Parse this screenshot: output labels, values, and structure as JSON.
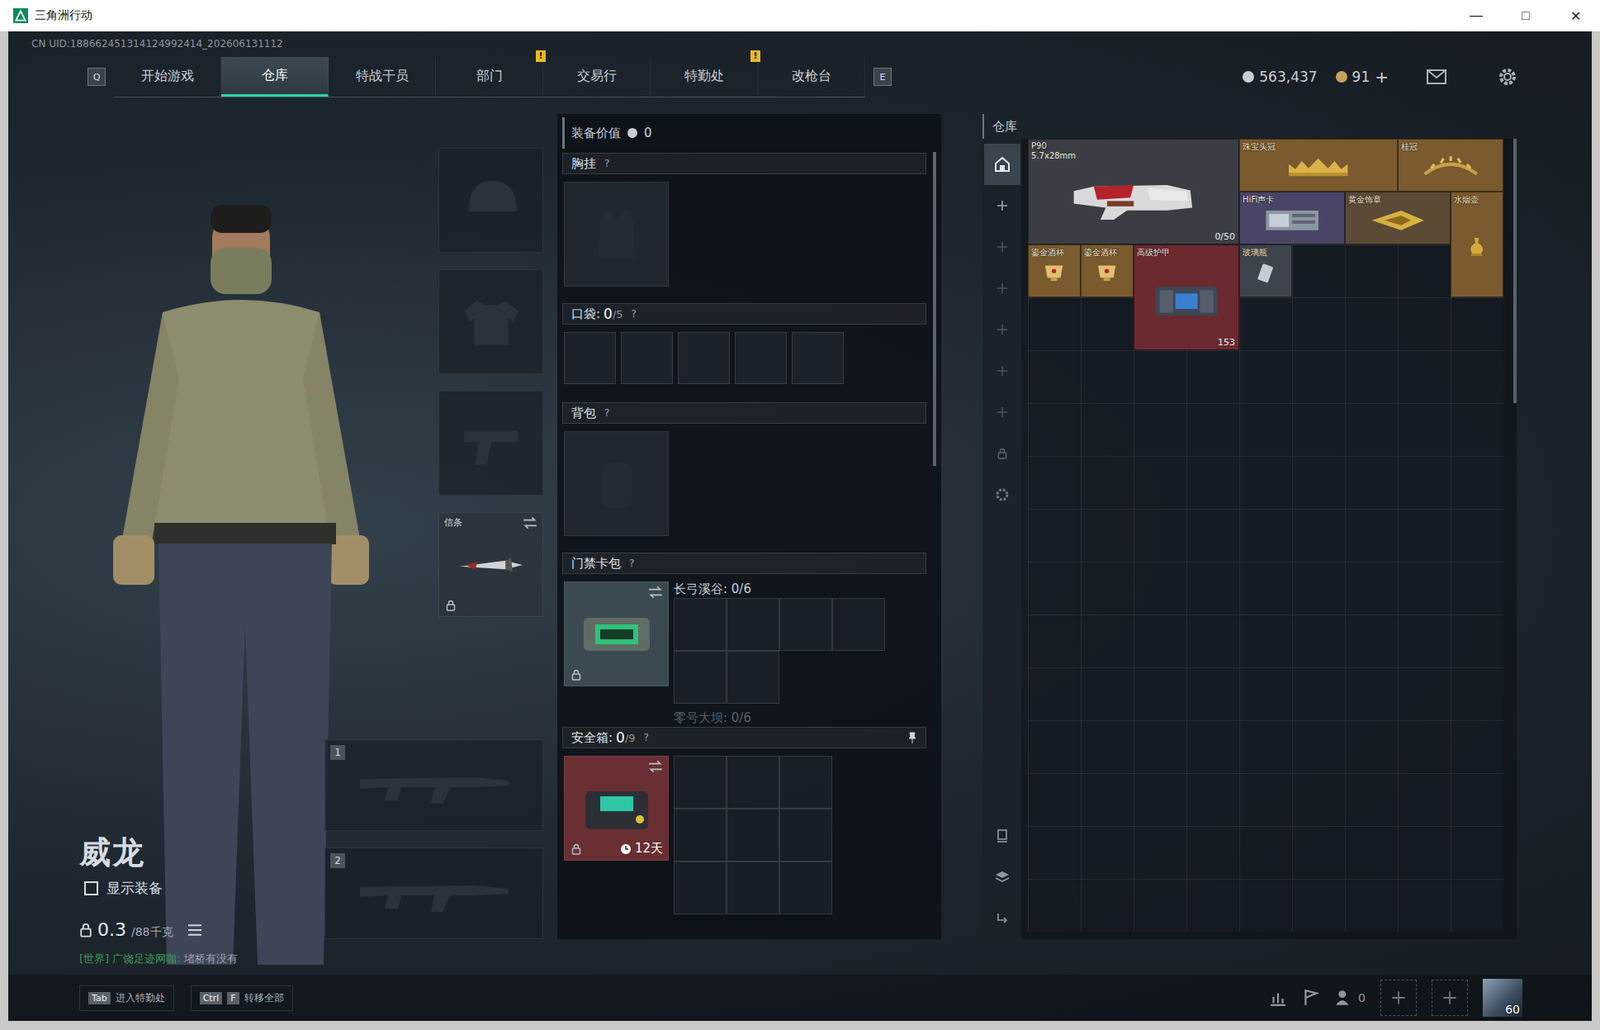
{
  "window": {
    "title": "三角洲行动",
    "controls": [
      "—",
      "□",
      "✕"
    ]
  },
  "uid": "CN UID:188662451314124992414_202606131112",
  "nav": {
    "prev_key": "Q",
    "next_key": "E",
    "tabs": [
      {
        "label": "开始游戏",
        "selected": false,
        "badge": null
      },
      {
        "label": "仓库",
        "selected": true,
        "badge": null
      },
      {
        "label": "特战干员",
        "selected": false,
        "badge": null
      },
      {
        "label": "部门",
        "selected": false,
        "badge": "!"
      },
      {
        "label": "交易行",
        "selected": false,
        "badge": null
      },
      {
        "label": "特勤处",
        "selected": false,
        "badge": "!"
      },
      {
        "label": "改枪台",
        "selected": false,
        "badge": null
      }
    ]
  },
  "currency": [
    {
      "value": "563,437",
      "color": "#c9ccd1",
      "add": null
    },
    {
      "value": "91",
      "color": "#c8a15a",
      "add": "+"
    }
  ],
  "operator": {
    "name": "威龙",
    "show_gear": {
      "label": "显示装备",
      "checked": false
    },
    "weight": "0.3",
    "capacity": "/88千克"
  },
  "chat": {
    "channel": "[世界]",
    "sender": "广饶足迹网咖:",
    "message": "堵桥有没有"
  },
  "gear_slots": [
    {
      "kind": "helmet",
      "label": "",
      "filled": false,
      "locked": false
    },
    {
      "kind": "armor",
      "label": "",
      "filled": false,
      "locked": false
    },
    {
      "kind": "pistol",
      "label": "",
      "filled": false,
      "locked": false
    },
    {
      "kind": "melee",
      "label": "信条",
      "filled": true,
      "locked": true
    }
  ],
  "weapon_slots": [
    {
      "number": "1"
    },
    {
      "number": "2"
    }
  ],
  "loadout": {
    "value_label": "装备价值",
    "value": "0",
    "chest_rig": {
      "label": "胸挂",
      "help": "?"
    },
    "pockets": {
      "label": "口袋: ",
      "used": "0",
      "capacity": "/5",
      "help": "?",
      "slots": 5
    },
    "backpack": {
      "label": "背包",
      "help": "?"
    },
    "keycard": {
      "label": "门禁卡包",
      "help": "?",
      "locked": true,
      "maps": [
        {
          "label": "长弓溪谷: 0/6",
          "dimmed": false
        },
        {
          "label": "零号大坝: 0/6",
          "dimmed": true
        }
      ]
    },
    "safe_box": {
      "label": "安全箱: ",
      "used": "0",
      "capacity": "/9",
      "help": "?",
      "timer": "12天",
      "locked": true,
      "slots": 9
    }
  },
  "warehouse": {
    "title": "仓库",
    "pages": [
      {
        "selected": true
      },
      {
        "selected": false
      },
      {
        "selected": false
      },
      {
        "selected": false
      },
      {
        "selected": false
      },
      {
        "selected": false
      },
      {
        "selected": false
      }
    ],
    "items": [
      {
        "name": "P90",
        "caliber": "5.7x28mm",
        "count": "0/50",
        "color": "#3a3e44"
      },
      {
        "name": "珠宝头冠",
        "caliber": "",
        "count": "",
        "color": "#7a5a2e"
      },
      {
        "name": "桂冠",
        "caliber": "",
        "count": "",
        "color": "#7a5a2e"
      },
      {
        "name": "HiFi声卡",
        "caliber": "",
        "count": "",
        "color": "#4a4566"
      },
      {
        "name": "黄金饰章",
        "caliber": "",
        "count": "",
        "color": "#5a4a36"
      },
      {
        "name": "水烟壶",
        "caliber": "",
        "count": "",
        "color": "#7a5a2e"
      },
      {
        "name": "鎏金酒杯",
        "caliber": "",
        "count": "",
        "color": "#7a5a2e"
      },
      {
        "name": "鎏金酒杯",
        "caliber": "",
        "count": "",
        "color": "#7a5a2e"
      },
      {
        "name": "高级护甲",
        "caliber": "",
        "count": "153",
        "color": "#6b2a30"
      },
      {
        "name": "玻璃瓶",
        "caliber": "",
        "count": "",
        "color": "#3e444b"
      }
    ]
  },
  "bottom": {
    "hints": [
      {
        "keys": [
          "Tab"
        ],
        "label": "进入特勤处"
      },
      {
        "keys": [
          "Ctrl",
          "F"
        ],
        "label": "转移全部"
      }
    ],
    "friends": "0",
    "level": "60"
  }
}
